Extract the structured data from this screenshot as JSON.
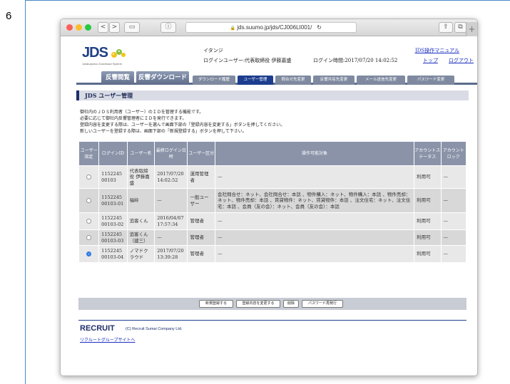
{
  "step_number": "6",
  "browser": {
    "url": "jds.suumo.jp/jds/CJ006LI001/",
    "nav_back": "<",
    "nav_forward": ">",
    "sidebar_icon": "▭",
    "info_icon": "ⓘ",
    "lock_icon": "🔒",
    "reload_icon": "↻",
    "share_icon": "⇧",
    "tabs_icon": "⧉",
    "plus": "+"
  },
  "header": {
    "logo": "JDS",
    "logo_subtitle": "Jutakujoutou Download System",
    "company": "イタンジ",
    "login_user": "ログインユーザー:代表取締役 伊藤嘉盛",
    "login_time": "ログイン時間:2017/07/20 14:02:52",
    "manual_link": "JDS操作マニュアル",
    "top_link": "トップ",
    "logout_link": "ログアウト"
  },
  "nav": {
    "main_tabs": [
      "反響閲覧",
      "反響ダウンロード"
    ],
    "sub_tabs": [
      "ダウンロード履歴",
      "ユーザー管理",
      "問合せ先変更",
      "反響共有先変更",
      "メール送信先変更",
      "パスワード変更"
    ],
    "active_sub": "ユーザー管理"
  },
  "section_title": "JDS ユーザー管理",
  "description": [
    "御社内のＪＤＳ利用者（ユーザー）のＩＤを管理する機能です。",
    "必要に応じて御社内反響管理者にＩＤを発行できます。",
    "登録内容を変更する際は、ユーザーを選んで画面下部の「登録内容を変更する」ボタンを押してください。",
    "新しいユーザーを登録する際は、画面下部の「新規登録する」ボタンを押して下さい。"
  ],
  "table": {
    "headers": [
      "ユーザー指定",
      "ログインID",
      "ユーザー名",
      "最終ログイン日時",
      "ユーザー区分",
      "操作可能対象",
      "アカウントステータス",
      "アカウントロック"
    ],
    "rows": [
      {
        "selected": false,
        "login_id": "1152245\n00103",
        "name": "代表取締役 伊藤嘉盛",
        "last_login": "2017/07/20 14:02:52",
        "type": "運用管理者",
        "scope": "—",
        "status": "利用可",
        "lock": "—"
      },
      {
        "selected": false,
        "login_id": "1152245\n00103-01",
        "name": "福岭",
        "last_login": "—",
        "type": "一般ユーザー",
        "scope": "会社問合せ：ネット、会社問合せ：本話 、物件購入：ネット、物件購入：本話 、物件売却：ネット、物件売却：本話 、賃貸物件：ネット、賃貸物件：本話 、注文住宅：ネット、注文住宅：本話 、会員（友の会）：ネット、会員（友の会）：本話",
        "status": "利用可",
        "lock": "—"
      },
      {
        "selected": false,
        "login_id": "1152245\n00103-02",
        "name": "追客くん",
        "last_login": "2016/04/07 17:57:34",
        "type": "管理者",
        "scope": "—",
        "status": "利用可",
        "lock": "—"
      },
      {
        "selected": false,
        "login_id": "1152245\n00103-03",
        "name": "追客くん（建三）",
        "last_login": "—",
        "type": "管理者",
        "scope": "—",
        "status": "利用可",
        "lock": "—"
      },
      {
        "selected": true,
        "login_id": "1152245\n00103-04",
        "name": "ノマドクラウド",
        "last_login": "2017/07/20 13:39:28",
        "type": "管理者",
        "scope": "—",
        "status": "利用可",
        "lock": "—"
      }
    ]
  },
  "buttons": {
    "new_register": "新規登録する",
    "change_register": "登録内容を変更する",
    "delete": "削除",
    "password_reissue": "パスワード再発行"
  },
  "footer": {
    "logo": "RECRUIT",
    "copyright": "(C) Recruit Sumai Company Ltd.",
    "group_link": "リクルートグループサイトへ"
  },
  "colors": {
    "nav_dark": "#1d3e8f",
    "header_bg": "#8a93a8",
    "link": "#1a2dbf"
  }
}
